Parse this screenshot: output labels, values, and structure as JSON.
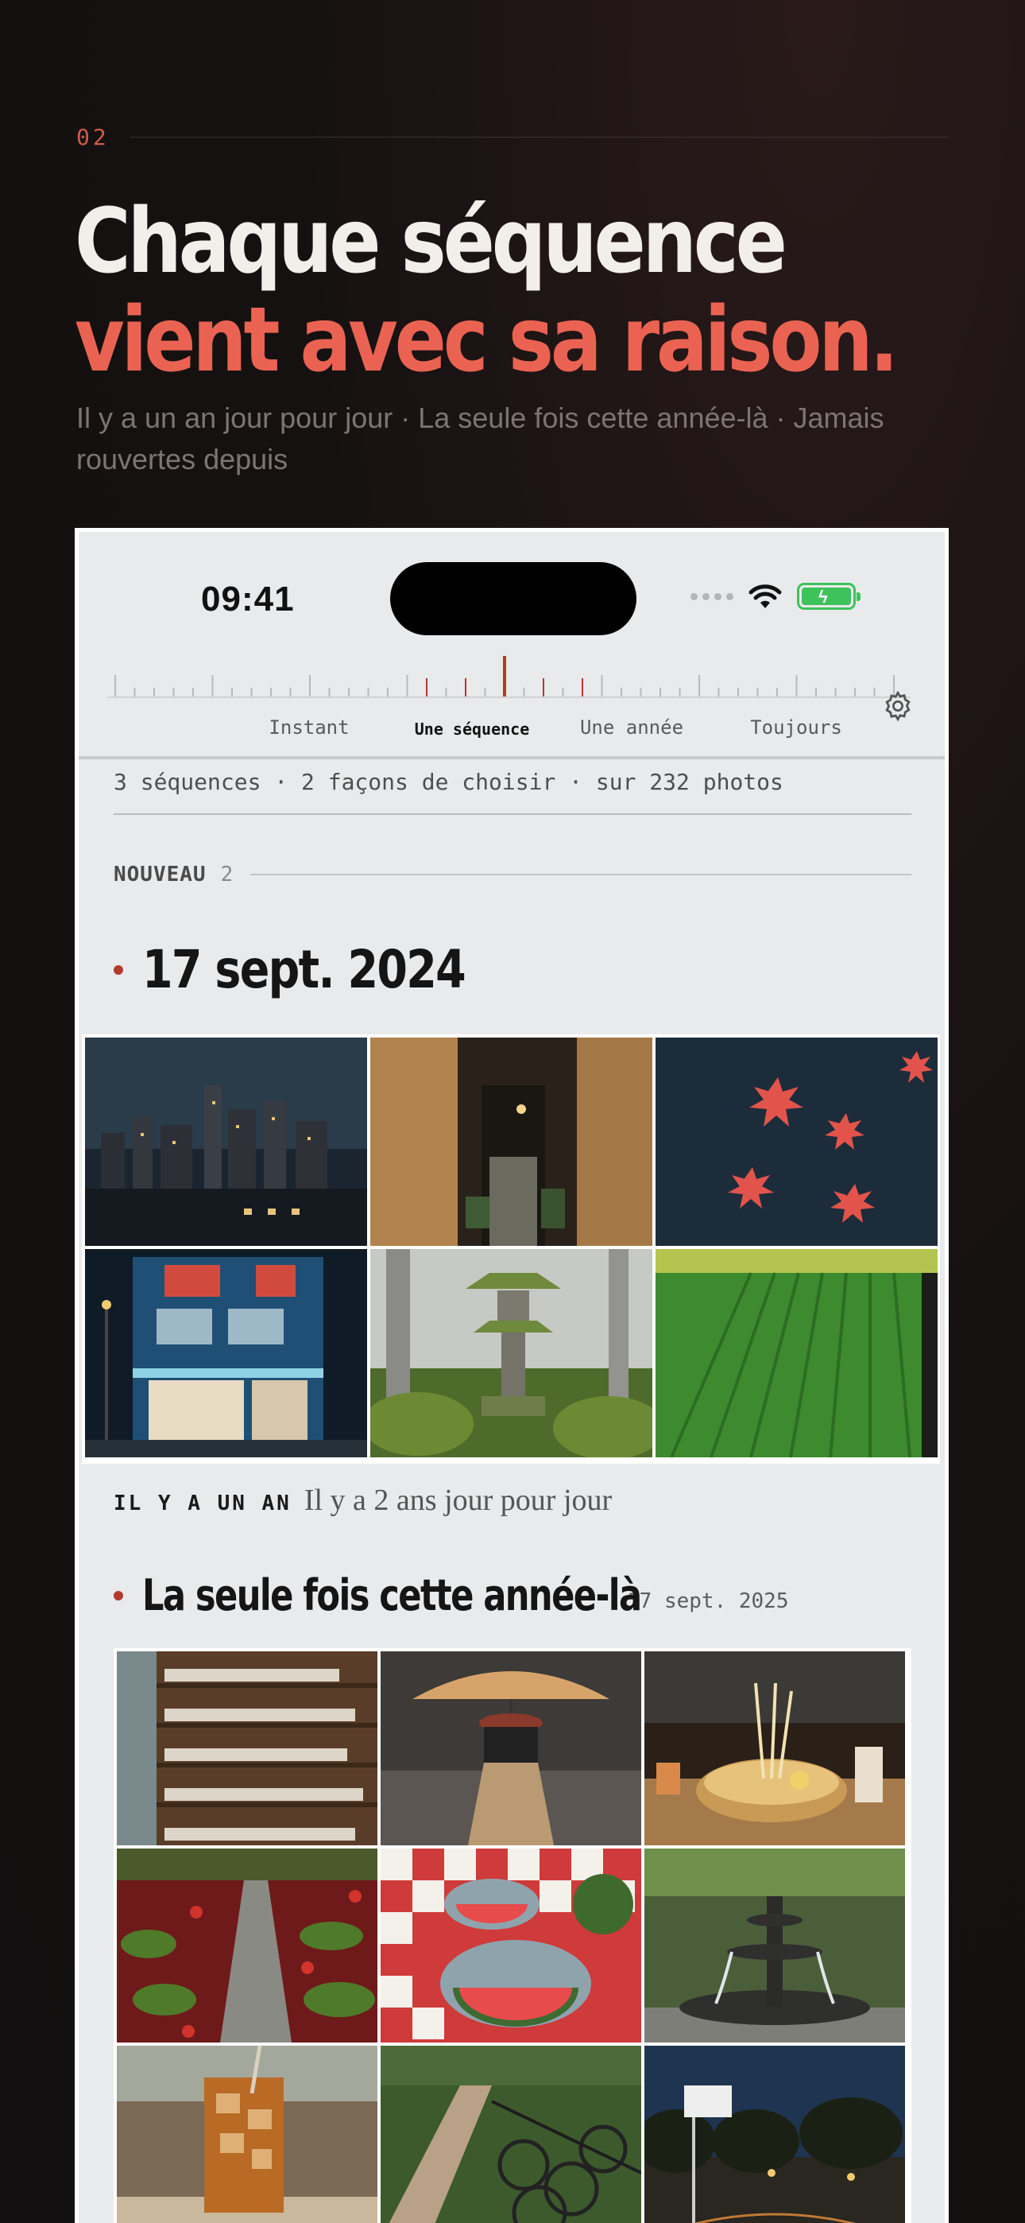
{
  "intro": {
    "step_number": "02",
    "headline_line1": "Chaque séquence",
    "headline_line2": "vient avec sa raison.",
    "subtitle": "Il y a un an jour pour jour · La seule fois cette année-là · Jamais rouvertes depuis",
    "accent_color": "#ea6352"
  },
  "status_bar": {
    "time": "09:41",
    "icons": [
      "cellular-dots-icon",
      "wifi-icon",
      "battery-charging-icon"
    ]
  },
  "scale": {
    "options": [
      "Instant",
      "Une séquence",
      "Une année",
      "Toujours"
    ],
    "selected": "Une séquence",
    "settings_icon": "gear-icon"
  },
  "summary": "3 séquences · 2 façons de choisir · sur 232 photos",
  "nouveau": {
    "label": "NOUVEAU",
    "count": "2"
  },
  "sequence1": {
    "date": "17 sept. 2024",
    "photos": [
      "night city skyline in rain",
      "narrow alley with curtains",
      "red maple leaves on water",
      "blue convenience store at night",
      "mossy stone lantern in forest",
      "green rice field"
    ],
    "memory_kicker": "IL Y A UN AN",
    "memory_text": "Il y a 2 ans jour pour jour"
  },
  "sequence2": {
    "title": "La seule fois cette année-là",
    "date": "17 sept. 2025",
    "photos": [
      "shelves of ceramic cups",
      "person with umbrella on street",
      "bowl of ramen with noodles",
      "stone path with red leaves",
      "watermelon slices on picnic cloth",
      "park fountain",
      "iced tea on cafe table",
      "bicycles along railing",
      "basketball court at dusk"
    ]
  }
}
